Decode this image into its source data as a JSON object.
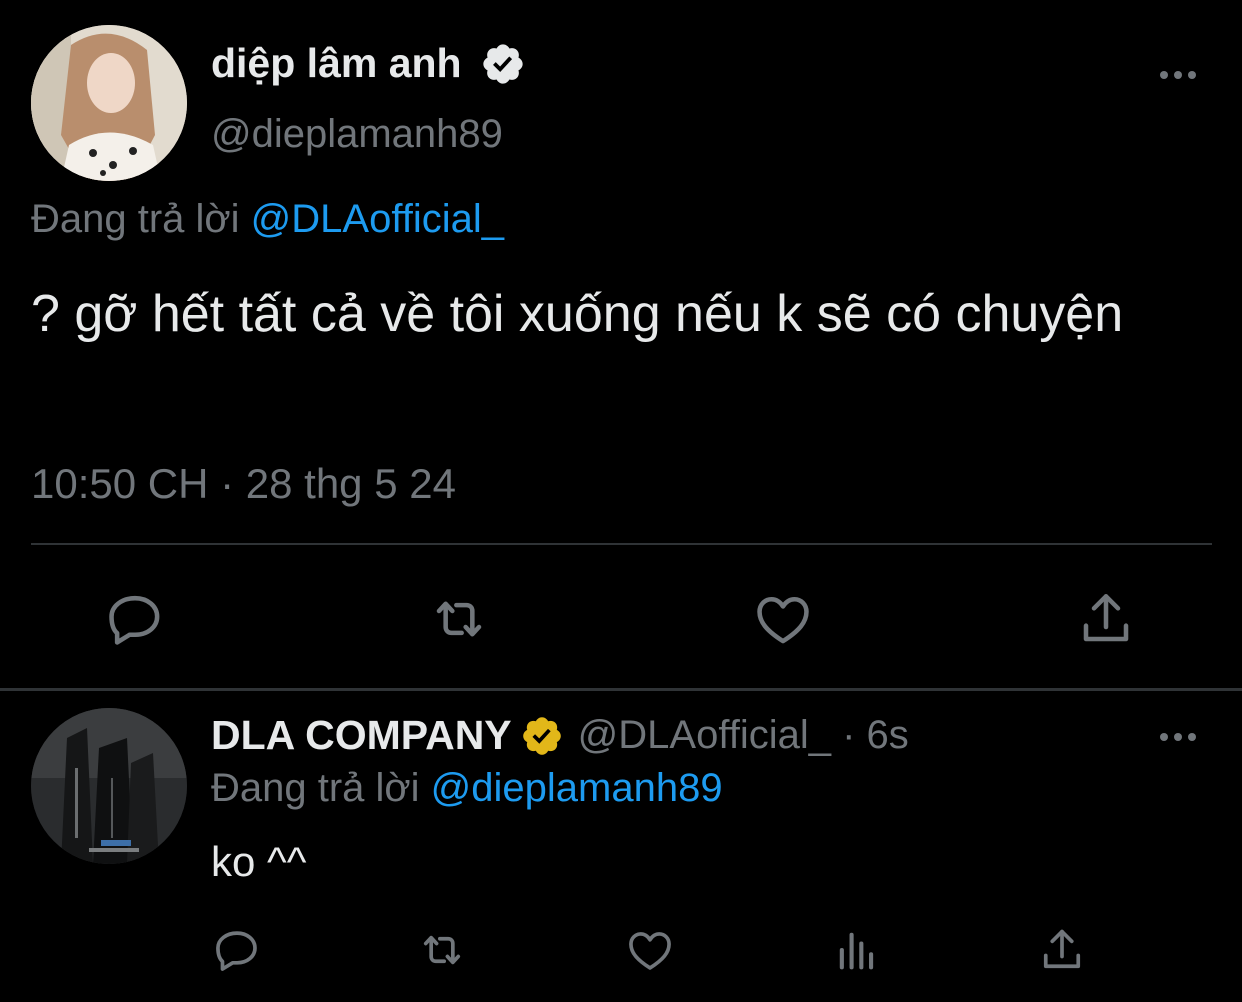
{
  "main_tweet": {
    "display_name": "diệp lâm anh",
    "handle": "@dieplamanh89",
    "replying_prefix": "Đang trả lời",
    "replying_to": "@DLAofficial_",
    "text": "? gỡ hết tất cả về tôi xuống nếu k sẽ có chuyện",
    "timestamp": "10:50 CH · 28 thg 5 24",
    "verified_badge_color": "#1d9bf0"
  },
  "reply_tweet": {
    "display_name": "DLA COMPANY",
    "handle_time": "@DLAofficial_ · 6s",
    "replying_prefix": "Đang trả lời",
    "replying_to": "@dieplamanh89",
    "text": "ko ^^",
    "verified_badge_color": "#e2b719"
  },
  "icons": {
    "main_actions": [
      "reply-icon",
      "retweet-icon",
      "like-icon",
      "share-icon"
    ],
    "reply_actions": [
      "reply-icon",
      "retweet-icon",
      "like-icon",
      "views-icon",
      "share-icon"
    ],
    "more": "more-options-icon"
  },
  "colors": {
    "background": "#000000",
    "text_primary": "#e7e9ea",
    "text_secondary": "#71767b",
    "link": "#1d9bf0",
    "divider": "#2f3336"
  }
}
